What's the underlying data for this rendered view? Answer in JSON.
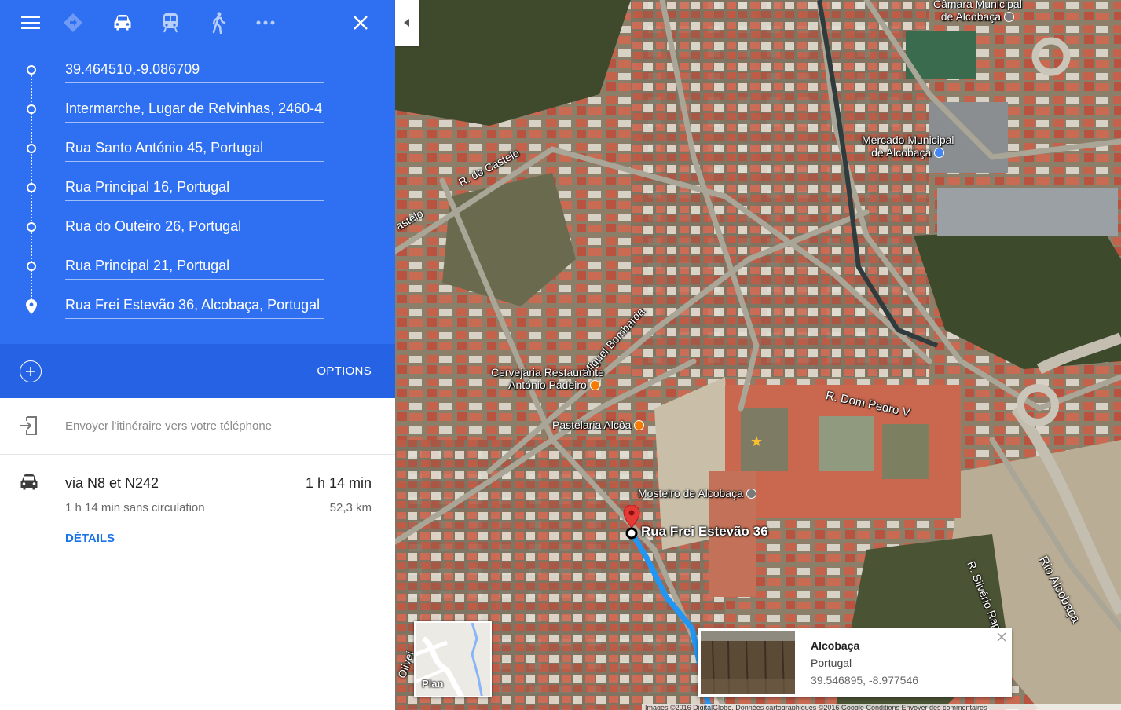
{
  "travel_modes": {
    "menu_icon": "hamburger-menu-icon",
    "items": [
      {
        "name": "best-route",
        "icon": "diamond-direction-icon"
      },
      {
        "name": "driving",
        "icon": "car-icon"
      },
      {
        "name": "transit",
        "icon": "train-icon"
      },
      {
        "name": "walking",
        "icon": "walking-person-icon"
      },
      {
        "name": "more",
        "icon": "more-dots-icon"
      }
    ],
    "close_icon": "close-icon"
  },
  "waypoints": [
    {
      "value": "39.464510,-9.086709"
    },
    {
      "value": "Intermarche, Lugar de Relvinhas, 2460-4"
    },
    {
      "value": "Rua Santo António 45, Portugal"
    },
    {
      "value": "Rua Principal 16, Portugal"
    },
    {
      "value": "Rua do Outeiro 26, Portugal"
    },
    {
      "value": "Rua Principal 21, Portugal"
    },
    {
      "value": "Rua Frei Estevão 36, Alcobaça, Portugal"
    }
  ],
  "options_label": "OPTIONS",
  "send_to_phone": "Envoyer l'itinéraire vers votre téléphone",
  "route": {
    "via": "via N8 et N242",
    "duration": "1 h 14 min",
    "no_traffic": "1 h 14 min sans circulation",
    "distance": "52,3 km",
    "details_label": "DÉTAILS"
  },
  "map": {
    "labels": {
      "camara": "Câmara Municipal",
      "camara2": "de Alcobaça",
      "mercado": "Mercado Municipal",
      "mercado2": "de Alcobaça",
      "castelo": "R. do Castelo",
      "astelo": "astelo",
      "bombarda": "Miguel Bombarda",
      "cervejaria": "Cervejaria Restaurante",
      "cervejaria2": "António Padeiro",
      "pastelaria": "Pastelaria Alcôa",
      "dompedro": "R. Dom Pedro V",
      "mosteiro": "Mosteiro de Alcobaça",
      "silverio": "R. Silvério Raposo",
      "rio": "Rio Alcobaça",
      "olivei": "Olivei"
    },
    "destination_label": "Rua Frei Estevão 36",
    "plan_label": "Plan",
    "attribution": "Images ©2016 DigitalGlobe, Données cartographiques ©2016 Google   Conditions   Envoyer des commentaires"
  },
  "card": {
    "title": "Alcobaça",
    "subtitle": "Portugal",
    "coords": "39.546895, -8.977546"
  },
  "colors": {
    "panel_blue": "#2f6ff2",
    "bar_blue": "#2662e4",
    "link_blue": "#1a73e8",
    "route_blue": "#2196f3"
  }
}
